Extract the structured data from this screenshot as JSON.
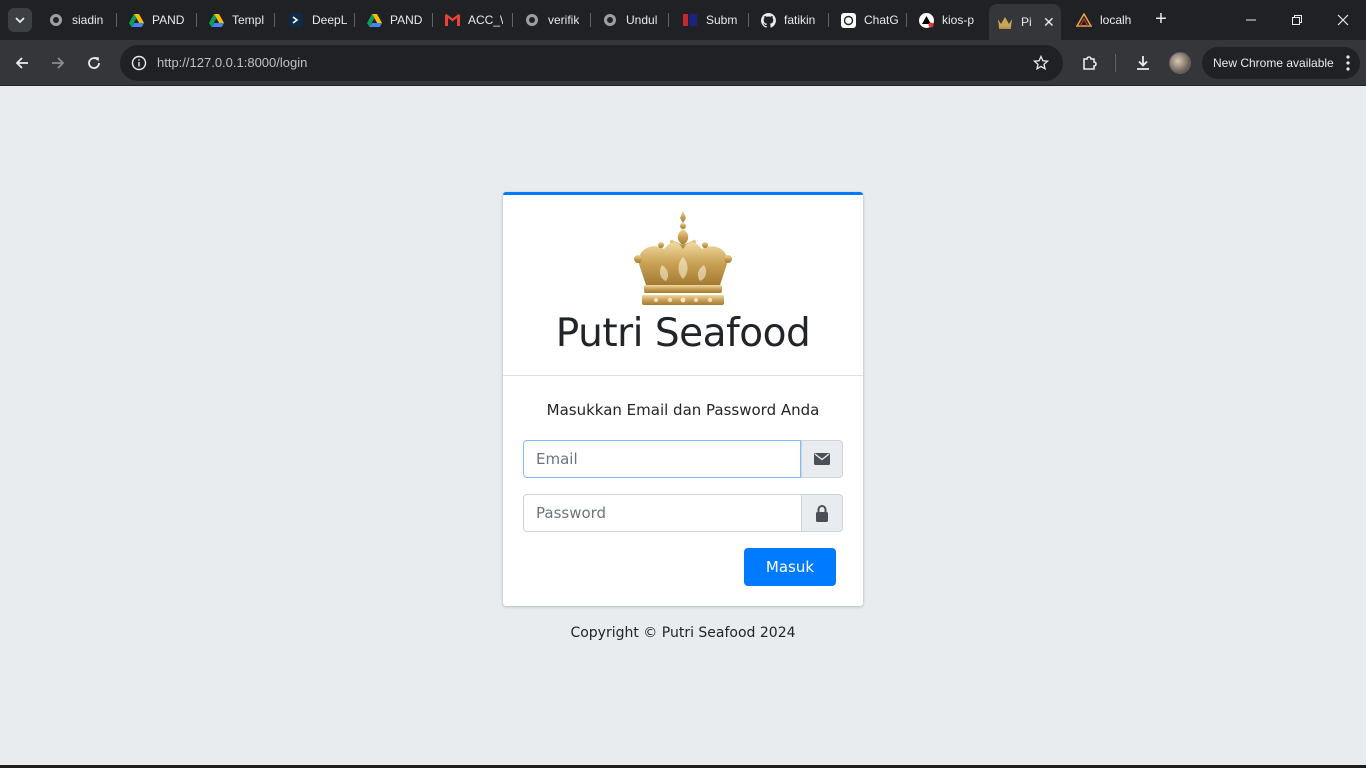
{
  "browser": {
    "tabs": [
      {
        "title": "siadin",
        "icon": "globe-icon"
      },
      {
        "title": "PAND",
        "icon": "google-drive-icon"
      },
      {
        "title": "Templ",
        "icon": "google-drive-icon"
      },
      {
        "title": "DeepL",
        "icon": "deepl-icon"
      },
      {
        "title": "PAND",
        "icon": "google-drive-icon"
      },
      {
        "title": "ACC_\\",
        "icon": "gmail-icon"
      },
      {
        "title": "verifik",
        "icon": "globe-icon"
      },
      {
        "title": "Undul",
        "icon": "globe-icon"
      },
      {
        "title": "Subm",
        "icon": "submission-icon"
      },
      {
        "title": "fatikin",
        "icon": "github-icon"
      },
      {
        "title": "ChatG",
        "icon": "chatgpt-icon"
      },
      {
        "title": "kios-p",
        "icon": "vercel-icon"
      },
      {
        "title": "Pi",
        "icon": "crown-icon",
        "active": true
      },
      {
        "title": "localh",
        "icon": "crown-icon"
      }
    ],
    "url": "http://127.0.0.1:8000/login",
    "update_label": "New Chrome available"
  },
  "login": {
    "brand": "Putri Seafood",
    "message": "Masukkan Email dan Password Anda",
    "email_placeholder": "Email",
    "password_placeholder": "Password",
    "submit_label": "Masuk",
    "accent_color": "#007bff"
  },
  "footer": {
    "copyright": "Copyright © Putri Seafood 2024"
  }
}
